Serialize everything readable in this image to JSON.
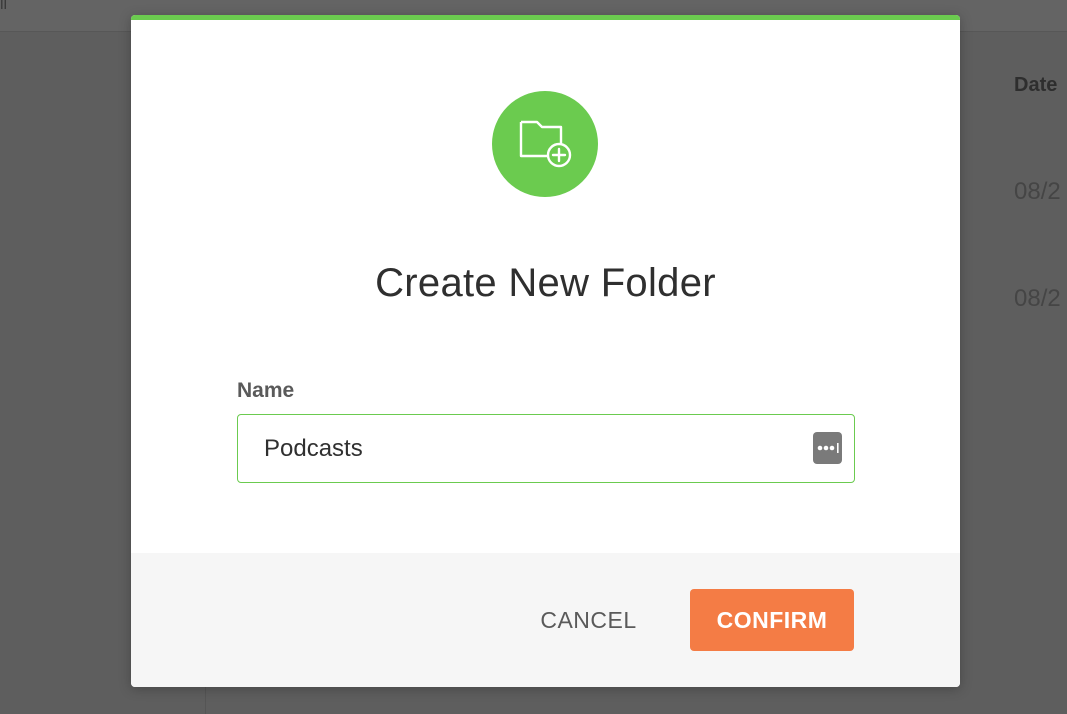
{
  "background": {
    "topbar_text": "ll",
    "column_header": "Date",
    "rows": [
      "08/2",
      "08/2"
    ]
  },
  "modal": {
    "icon": "folder-plus-icon",
    "title": "Create New Folder",
    "name_label": "Name",
    "name_value": "Podcasts",
    "password_manager_icon": "password-manager-icon",
    "cancel_label": "CANCEL",
    "confirm_label": "CONFIRM"
  },
  "colors": {
    "accent_green": "#6bcb4f",
    "confirm_orange": "#f47c45",
    "overlay_gray": "#5f5f5f"
  }
}
